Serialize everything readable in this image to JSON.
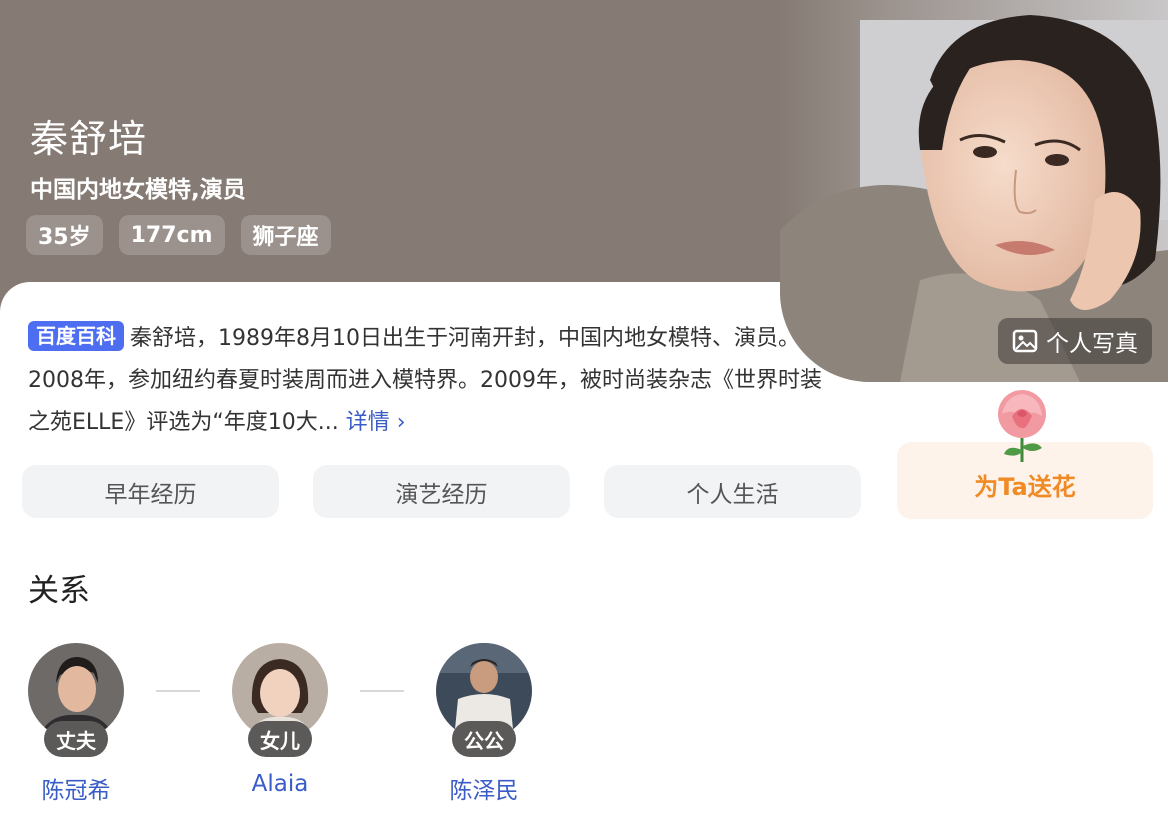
{
  "profile": {
    "name": "秦舒培",
    "subtitle": "中国内地女模特,演员",
    "tags": [
      "35岁",
      "177cm",
      "狮子座"
    ],
    "photo_button": "个人写真"
  },
  "bio": {
    "source": "百度百科",
    "text": "秦舒培，1989年8月10日出生于河南开封，中国内地女模特、演员。2008年，参加纽约春夏时装周而进入模特界。2009年，被时尚装杂志《世界时装之苑ELLE》评选为“年度10大...",
    "more": "详情",
    "more_icon": "chevron-right-icon"
  },
  "tabs": [
    "早年经历",
    "演艺经历",
    "个人生活"
  ],
  "flower": {
    "label": "为Ta送花",
    "icon": "rose-icon"
  },
  "relations": {
    "title": "关系",
    "people": [
      {
        "role": "丈夫",
        "name": "陈冠希"
      },
      {
        "role": "女儿",
        "name": "Alaia"
      },
      {
        "role": "公公",
        "name": "陈泽民"
      }
    ]
  },
  "colors": {
    "header_bg": "#857b74",
    "accent_blue": "#4e6ef2",
    "link_blue": "#3a5cc7",
    "flower_orange": "#f08a24"
  }
}
